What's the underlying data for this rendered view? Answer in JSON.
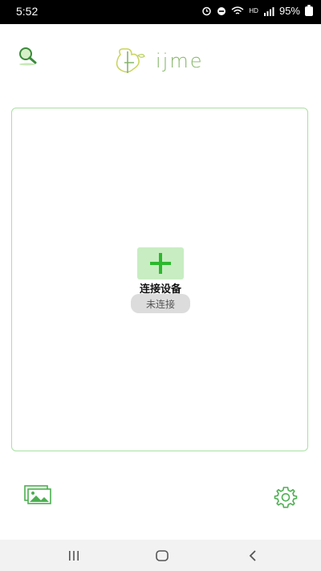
{
  "status_bar": {
    "time": "5:52",
    "battery": "95%",
    "network_badge": "HD"
  },
  "header": {
    "logo_text": "ijme",
    "search_icon": "search-icon"
  },
  "device_panel": {
    "add_icon": "plus-icon",
    "connect_label": "连接设备",
    "status": "未连接"
  },
  "bottom_bar": {
    "gallery_icon": "gallery-icon",
    "settings_icon": "gear-icon"
  },
  "nav": {
    "recents_icon": "recents-icon",
    "home_icon": "home-icon",
    "back_icon": "back-icon"
  },
  "colors": {
    "accent": "#2db82d",
    "panel_border": "#a9e0a2",
    "add_button_bg": "#c8edc2",
    "status_pill_bg": "#dcdcdc"
  }
}
